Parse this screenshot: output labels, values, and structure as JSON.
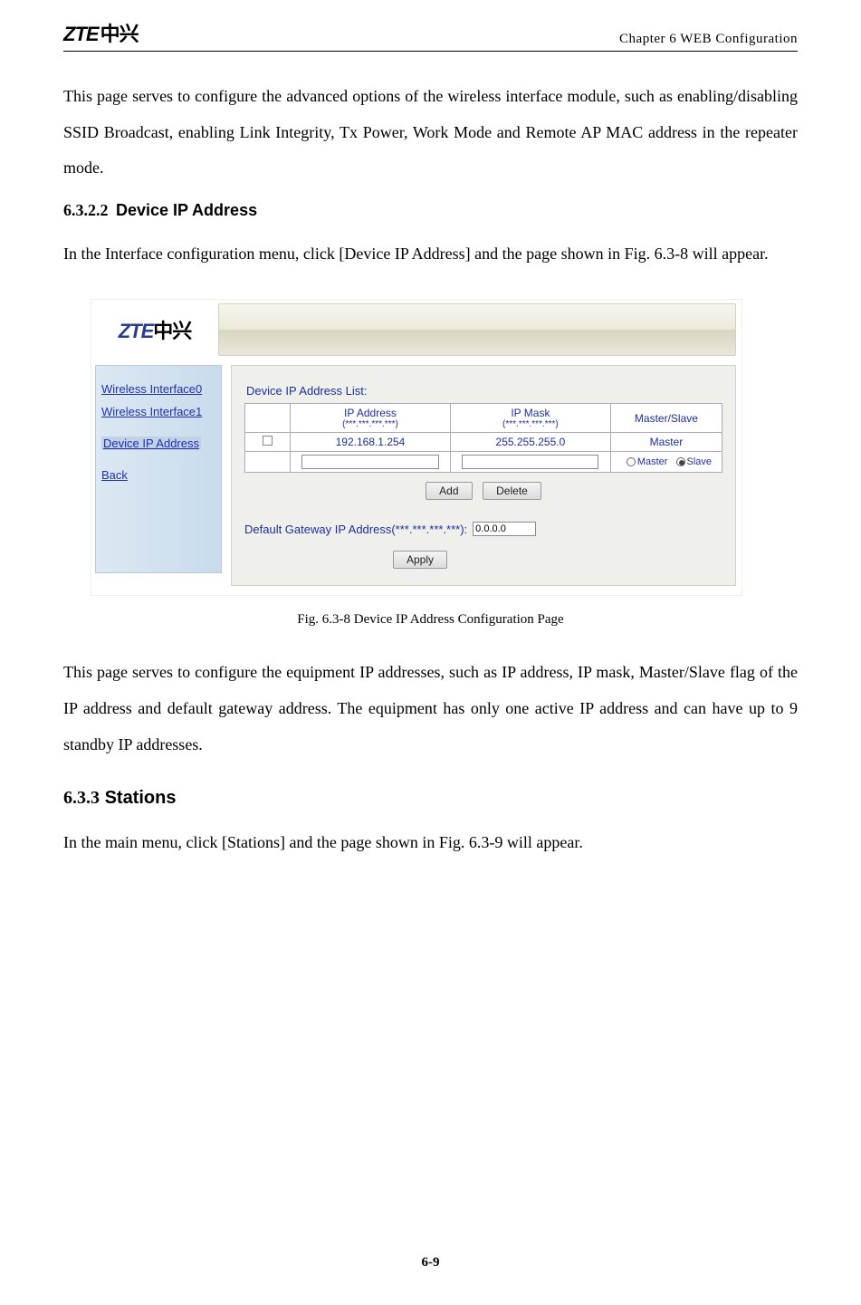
{
  "header": {
    "logo_en": "ZTE",
    "logo_cn": "中兴",
    "chapter": "Chapter 6 WEB Configuration"
  },
  "para1": "This page serves to configure the advanced options of the wireless interface module, such as enabling/disabling SSID Broadcast, enabling Link Integrity, Tx Power, Work Mode and Remote AP MAC address in the repeater mode.",
  "h_6322_num": "6.3.2.2",
  "h_6322_title": "Device IP Address",
  "para2": "In the Interface configuration menu, click [Device IP Address] and the page shown in Fig. 6.3-8 will appear.",
  "figure": {
    "logo_en": "ZTE",
    "logo_cn": "中兴",
    "sidebar": {
      "items": [
        "Wireless Interface0",
        "Wireless Interface1",
        "Device IP Address",
        "Back"
      ],
      "selected_index": 2
    },
    "panel": {
      "list_label": "Device IP Address List:",
      "headers": {
        "checkbox": "",
        "ip": "IP Address",
        "ip_sub": "(***.***.***.***)",
        "mask": "IP Mask",
        "mask_sub": "(***.***.***.***)",
        "ms": "Master/Slave"
      },
      "row1": {
        "ip": "192.168.1.254",
        "mask": "255.255.255.0",
        "ms": "Master"
      },
      "row_input": {
        "ip_value": "",
        "mask_value": "",
        "master_label": "Master",
        "slave_label": "Slave"
      },
      "btn_add": "Add",
      "btn_delete": "Delete",
      "gw_label": "Default Gateway IP Address(***.***.***.***):",
      "gw_value": "0.0.0.0",
      "btn_apply": "Apply"
    }
  },
  "fig_caption": "Fig. 6.3-8    Device IP Address Configuration Page",
  "para3": "This page serves to configure the equipment IP addresses, such as IP address, IP mask, Master/Slave flag of the IP address and default gateway address. The equipment has only one active IP address and can have up to 9 standby IP addresses.",
  "h_633_num": "6.3.3",
  "h_633_title": "Stations",
  "para4": "In the main menu, click [Stations] and the page shown in Fig. 6.3-9 will appear.",
  "page_number": "6-9"
}
